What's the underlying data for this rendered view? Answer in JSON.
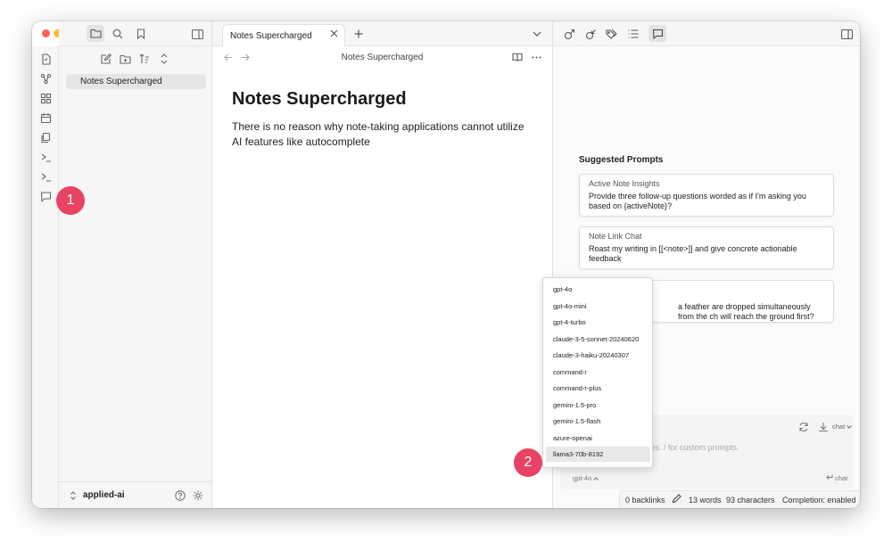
{
  "sidebar": {
    "files": [
      {
        "label": "Notes Supercharged"
      }
    ],
    "vault_name": "applied-ai"
  },
  "tab": {
    "label": "Notes Supercharged"
  },
  "view_header": {
    "title": "Notes Supercharged"
  },
  "note": {
    "title": "Notes Supercharged",
    "body": "There is no reason why note-taking applications cannot utilize AI features like autocomplete"
  },
  "right_panel": {
    "suggested_heading": "Suggested Prompts",
    "cards": [
      {
        "title": "Active Note Insights",
        "text": "Provide three follow-up questions worded as if I'm asking you based on {activeNote}?"
      },
      {
        "title": "Note Link Chat",
        "text": "Roast my writing in [[<note>]] and give concrete actionable feedback"
      },
      {
        "title": "",
        "text": "a feather are dropped simultaneously from the ch will reach the ground first?"
      }
    ],
    "mode_label": "chat",
    "input_placeholder": "tes. / for custom prompts.",
    "model_selector": "gpt-4o",
    "send_label": "chat"
  },
  "model_menu": {
    "options": [
      "gpt-4o",
      "gpt-4o-mini",
      "gpt-4-turbo",
      "claude-3-5-sonnet-20240620",
      "claude-3-haiku-20240307",
      "command-r",
      "command-r-plus",
      "gemini-1.5-pro",
      "gemini-1.5-flash",
      "azure-openai",
      "llama3-70b-8192"
    ],
    "selected": "llama3-70b-8192"
  },
  "statusbar": {
    "backlinks": "0 backlinks",
    "words": "13 words",
    "characters": "93 characters",
    "completion": "Completion: enabled"
  },
  "annotations": {
    "badge1": "1",
    "badge2": "2"
  },
  "colors": {
    "badge": "#e94364",
    "traffic_red": "#fe5f57",
    "traffic_yellow": "#febc2e",
    "traffic_green": "#28c840"
  }
}
